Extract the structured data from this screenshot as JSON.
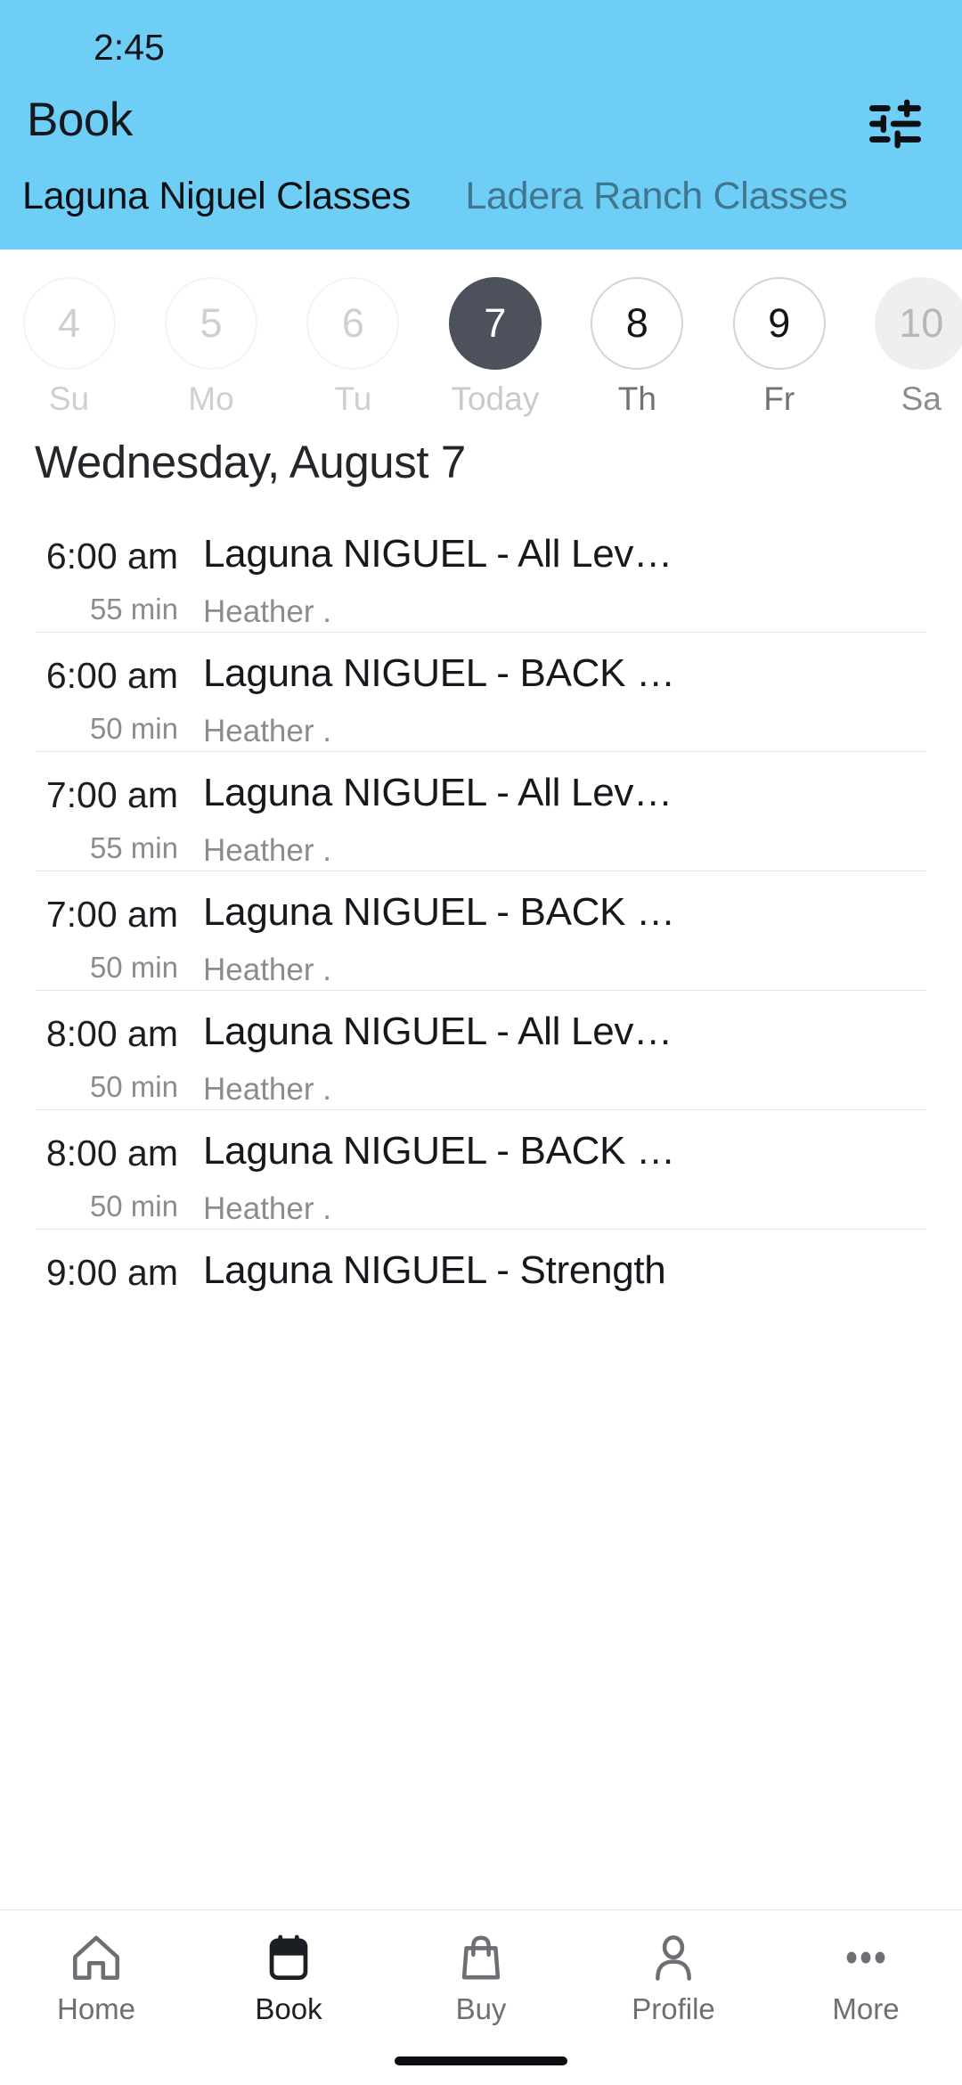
{
  "colors": {
    "header_blue": "#6ECEF5",
    "selected_day": "#4d515c",
    "inactive_tab_text": "#3f7790",
    "muted_text": "#8a8c90"
  },
  "status_bar": {
    "time": "2:45"
  },
  "header": {
    "title": "Book",
    "filter_icon": "tune-icon",
    "tabs": [
      {
        "label": "Laguna Niguel Classes",
        "active": true
      },
      {
        "label": "Ladera Ranch Classes",
        "active": false
      }
    ]
  },
  "date_strip": [
    {
      "day": "4",
      "weekday": "Su",
      "state": "past"
    },
    {
      "day": "5",
      "weekday": "Mo",
      "state": "past"
    },
    {
      "day": "6",
      "weekday": "Tu",
      "state": "past"
    },
    {
      "day": "7",
      "weekday": "Today",
      "state": "selected"
    },
    {
      "day": "8",
      "weekday": "Th",
      "state": "available"
    },
    {
      "day": "9",
      "weekday": "Fr",
      "state": "available"
    },
    {
      "day": "10",
      "weekday": "Sa",
      "state": "muted"
    }
  ],
  "day_heading": "Wednesday, August 7",
  "classes": [
    {
      "time": "6:00 am",
      "duration": "55 min",
      "name": "Laguna NIGUEL - All Lev…",
      "instructor": "Heather ."
    },
    {
      "time": "6:00 am",
      "duration": "50 min",
      "name": "Laguna NIGUEL - BACK …",
      "instructor": "Heather ."
    },
    {
      "time": "7:00 am",
      "duration": "55 min",
      "name": "Laguna NIGUEL - All Lev…",
      "instructor": "Heather ."
    },
    {
      "time": "7:00 am",
      "duration": "50 min",
      "name": "Laguna NIGUEL - BACK …",
      "instructor": "Heather ."
    },
    {
      "time": "8:00 am",
      "duration": "50 min",
      "name": "Laguna NIGUEL - All Lev…",
      "instructor": "Heather ."
    },
    {
      "time": "8:00 am",
      "duration": "50 min",
      "name": "Laguna NIGUEL - BACK …",
      "instructor": "Heather ."
    },
    {
      "time": "9:00 am",
      "duration": "",
      "name": "Laguna NIGUEL - Strength",
      "instructor": ""
    }
  ],
  "bottom_nav": [
    {
      "label": "Home",
      "icon": "home-icon",
      "active": false
    },
    {
      "label": "Book",
      "icon": "calendar-icon",
      "active": true
    },
    {
      "label": "Buy",
      "icon": "bag-icon",
      "active": false
    },
    {
      "label": "Profile",
      "icon": "person-icon",
      "active": false
    },
    {
      "label": "More",
      "icon": "ellipsis-icon",
      "active": false
    }
  ]
}
